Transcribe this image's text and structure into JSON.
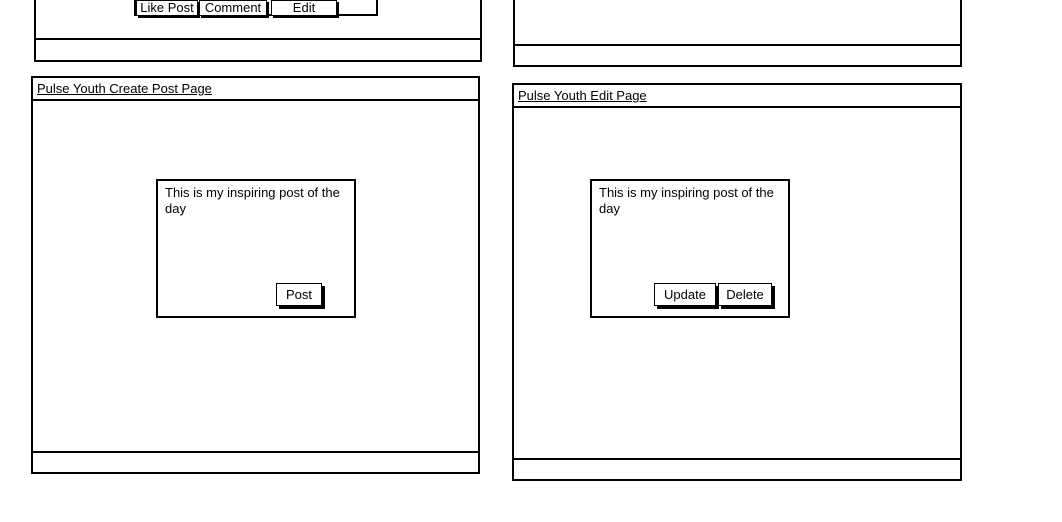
{
  "top_left_panel": {
    "buttons": {
      "like_post": "Like Post",
      "comment": "Comment",
      "edit": "Edit"
    }
  },
  "create_post_page": {
    "title": "Pulse Youth Create Post Page",
    "post_text": "This is my inspiring post of the day",
    "post_button": "Post"
  },
  "edit_page": {
    "title": "Pulse Youth Edit Page",
    "post_text": "This is my inspiring post of the day",
    "update_button": "Update",
    "delete_button": "Delete"
  }
}
